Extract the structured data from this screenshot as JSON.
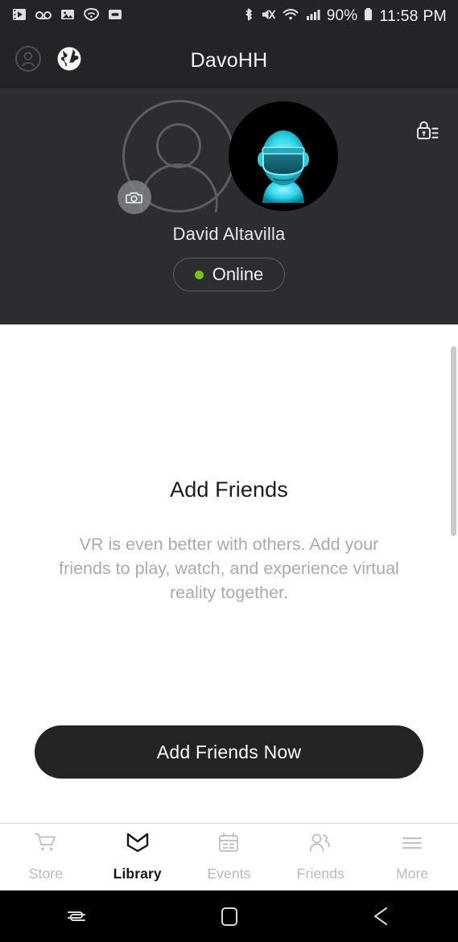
{
  "status_bar": {
    "left_icons": [
      "video-player-icon",
      "voicemail-icon",
      "photo-icon",
      "wifi-shield-icon",
      "capsule-icon"
    ],
    "right_icons": [
      "bluetooth-icon",
      "mute-icon",
      "wifi-icon",
      "cellular-signal-icon"
    ],
    "battery_percent": "90%",
    "time": "11:58 PM"
  },
  "header": {
    "title": "DavoHH",
    "avatar_icon": "person-circle-icon",
    "globe_icon": "globe-icon"
  },
  "profile": {
    "name": "David Altavilla",
    "status_label": "Online",
    "status_color": "#7ac10f",
    "camera_badge_icon": "camera-icon",
    "privacy_icon": "privacy-lock-icon",
    "avatar_placeholder_icon": "person-placeholder-icon",
    "avatar_vr_icon": "vr-avatar-icon",
    "background_color": "#2b2d30"
  },
  "empty_state": {
    "title": "Add Friends",
    "description": "VR is even better with others. Add your friends to play, watch, and experience virtual reality together.",
    "cta_label": "Add Friends Now"
  },
  "tab_bar": {
    "items": [
      {
        "label": "Store",
        "icon": "cart-icon",
        "active": false
      },
      {
        "label": "Library",
        "icon": "book-icon",
        "active": true
      },
      {
        "label": "Events",
        "icon": "calendar-icon",
        "active": false
      },
      {
        "label": "Friends",
        "icon": "people-icon",
        "active": false
      },
      {
        "label": "More",
        "icon": "menu-icon",
        "active": false
      }
    ]
  },
  "nav_bar": {
    "recents_icon": "recents-icon",
    "home_icon": "home-icon",
    "back_icon": "back-icon"
  }
}
